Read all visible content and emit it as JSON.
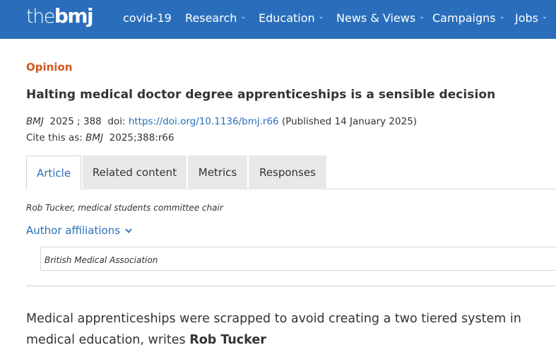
{
  "header": {
    "logo": {
      "the": "the",
      "bmj": "bmj"
    },
    "nav": [
      {
        "label": "covid-19",
        "has_dropdown": false
      },
      {
        "label": "Research",
        "has_dropdown": true
      },
      {
        "label": "Education",
        "has_dropdown": true
      },
      {
        "label": "News & Views",
        "has_dropdown": true
      },
      {
        "label": "Campaigns",
        "has_dropdown": true
      },
      {
        "label": "Jobs",
        "has_dropdown": true
      }
    ],
    "chevron": "⌄"
  },
  "article": {
    "kicker": "Opinion",
    "title": "Halting medical doctor degree apprenticeships is a sensible decision",
    "citation": {
      "journal": "BMJ",
      "year": "2025",
      "sep": ";",
      "volume": "388",
      "doi_label": "doi:",
      "doi_url": "https://doi.org/10.1136/bmj.r66",
      "published": "(Published 14 January 2025)"
    },
    "cite_as": {
      "label": "Cite this as:",
      "journal": "BMJ",
      "ref": "2025;388:r66"
    },
    "tabs": [
      {
        "label": "Article",
        "active": true
      },
      {
        "label": "Related content",
        "active": false
      },
      {
        "label": "Metrics",
        "active": false
      },
      {
        "label": "Responses",
        "active": false
      }
    ],
    "author_line": "Rob Tucker, medical students committee chair",
    "affiliations_toggle": "Author affiliations",
    "affiliation": "British Medical Association",
    "standfirst_text": "Medical apprenticeships were scrapped to avoid creating a two tiered system in medical education, writes",
    "standfirst_author": "Rob Tucker"
  },
  "colors": {
    "brand_blue": "#2a6ebb",
    "kicker_orange": "#d1561d",
    "tab_inactive_bg": "#e8e8e8"
  }
}
